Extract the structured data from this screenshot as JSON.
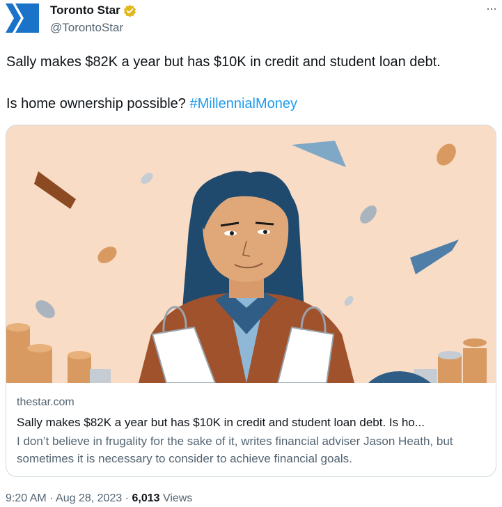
{
  "account": {
    "name": "Toronto Star",
    "handle": "@TorontoStar",
    "avatar_icon": "toronto-star-logo",
    "verified_icon": "verified-gold-badge",
    "more_label": "···"
  },
  "tweet": {
    "text_line1": "Sally makes $82K a year but has $10K in credit and student loan debt.",
    "text_line2_prefix": "Is home ownership possible? ",
    "hashtag": "#MillennialMoney"
  },
  "link_card": {
    "domain": "thestar.com",
    "title": "Sally makes $82K a year but has $10K in credit and student loan debt. Is ho...",
    "description": "I don’t believe in frugality for the sake of it, writes financial adviser Jason Heath, but sometimes it is necessary to consider to achieve financial goals."
  },
  "footer": {
    "time": "9:20 AM",
    "sep1": " · ",
    "date": "Aug 28, 2023",
    "sep2": " · ",
    "views_count": "6,013",
    "views_label": " Views"
  },
  "colors": {
    "accent": "#1d9bf0",
    "logo_blue": "#1a73c8",
    "illustration_bg": "#f9dcc6"
  }
}
